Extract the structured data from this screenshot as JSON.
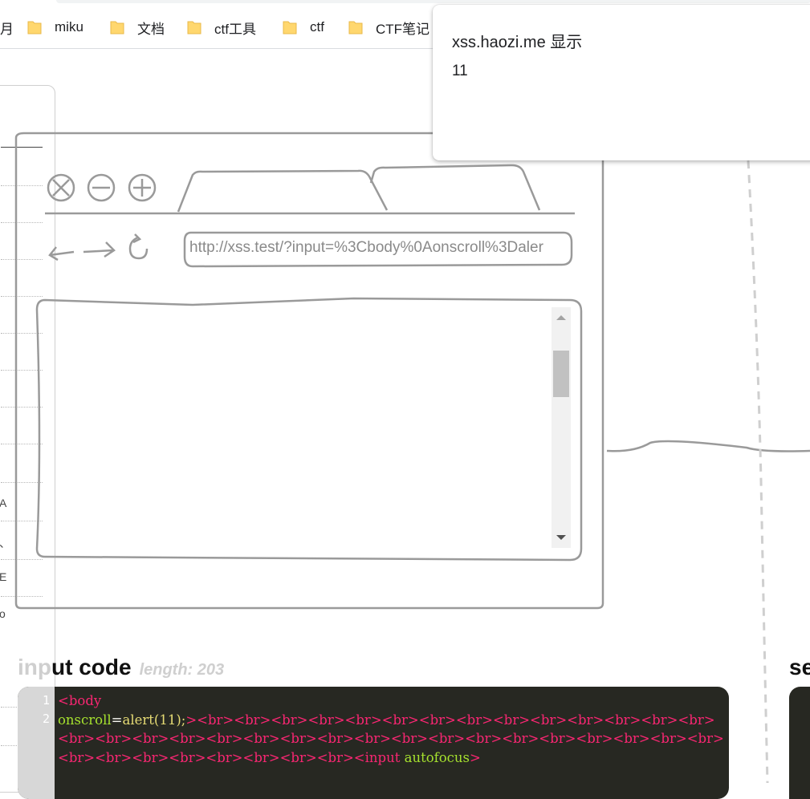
{
  "bookmarks": {
    "cut_label": "月",
    "items": [
      {
        "label": "miku",
        "icon": "folder-icon"
      },
      {
        "label": "文档",
        "icon": "folder-icon"
      },
      {
        "label": "ctf工具",
        "icon": "folder-icon"
      },
      {
        "label": "ctf",
        "icon": "folder-icon"
      },
      {
        "label": "CTF笔记",
        "icon": "folder-icon"
      }
    ]
  },
  "sketch_browser": {
    "url": "http://xss.test/?input=%3Cbody%0Aonscroll%3Daler",
    "controls": [
      "close-icon",
      "minimize-icon",
      "maximize-icon"
    ],
    "nav": [
      "back-arrow-icon",
      "forward-arrow-icon",
      "reload-icon"
    ]
  },
  "sidebar": {
    "glyphs": [
      "A",
      "、",
      "E",
      "o"
    ]
  },
  "input_section": {
    "title_faded": "inp",
    "title_rest": "ut code",
    "length_label": "length: 203",
    "line_numbers": [
      "1",
      "2"
    ],
    "code_line1": "<body",
    "code_attr": "onscroll",
    "code_eq": "=",
    "code_val": "alert(11);",
    "code_tags": "><br><br><br><br><br><br><br><br><br><br><br><br><br><br><br><br><br><br><br><br><br><br><br><br><br><br><br><br><br><br><br><br><br><br><br><br><br><br><br><br><input",
    "code_attr2": " autofocus",
    "code_end": ">"
  },
  "right_section": {
    "title": "se"
  },
  "alert_dialog": {
    "title": "xss.haozi.me 显示",
    "message": "11"
  },
  "colors": {
    "editor_bg": "#272822",
    "tag": "#f92672",
    "attr": "#a6e22e",
    "value": "#e6db74"
  }
}
